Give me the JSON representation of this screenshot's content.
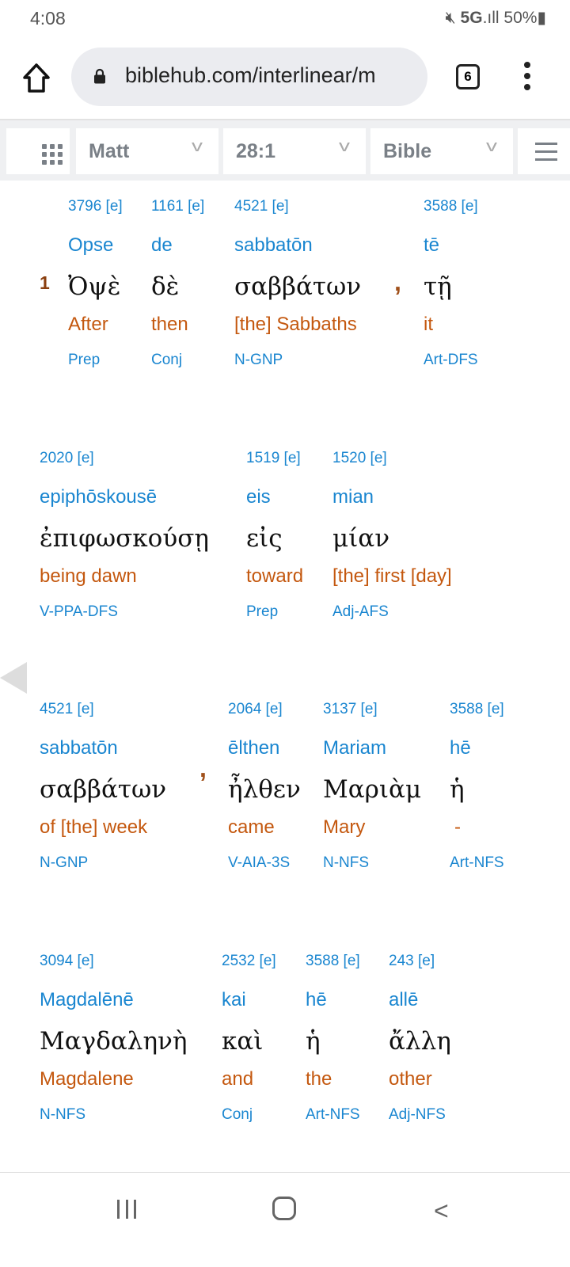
{
  "status": {
    "time": "4:08",
    "icons": "mute-icon 5G signal-icon",
    "battery": "50%",
    "network": "5G"
  },
  "browser": {
    "url": "biblehub.com/interlinear/m",
    "tab_count": "6"
  },
  "nav": {
    "book": "Matt",
    "chapter_verse": "28:1",
    "version": "Bible"
  },
  "verse": {
    "number": "1"
  },
  "colors": {
    "link": "#1a86d0",
    "english": "#c4580f",
    "verse_number": "#8b4010"
  },
  "words": [
    {
      "strong": "3796 [e]",
      "translit": "Opse",
      "greek": "Ὀψὲ",
      "english": "After",
      "parse": "Prep"
    },
    {
      "strong": "1161 [e]",
      "translit": "de",
      "greek": "δὲ",
      "english": "then",
      "parse": "Conj"
    },
    {
      "strong": "4521 [e]",
      "translit": "sabbatōn",
      "greek": "σαββάτων",
      "english": "[the] Sabbaths",
      "parse": "N-GNP"
    },
    {
      "strong": "3588 [e]",
      "translit": "tē",
      "greek": "τῇ",
      "english": "it",
      "parse": "Art-DFS"
    },
    {
      "strong": "2020 [e]",
      "translit": "epiphōskousē",
      "greek": "ἐπιφωσκούσῃ",
      "english": "being dawn",
      "parse": "V-PPA-DFS"
    },
    {
      "strong": "1519 [e]",
      "translit": "eis",
      "greek": "εἰς",
      "english": "toward",
      "parse": "Prep"
    },
    {
      "strong": "1520 [e]",
      "translit": "mian",
      "greek": "μίαν",
      "english": "[the] first [day]",
      "parse": "Adj-AFS"
    },
    {
      "strong": "4521 [e]",
      "translit": "sabbatōn",
      "greek": "σαββάτων",
      "english": "of [the] week",
      "parse": "N-GNP"
    },
    {
      "strong": "2064 [e]",
      "translit": "ēlthen",
      "greek": "ἦλθεν",
      "english": "came",
      "parse": "V-AIA-3S"
    },
    {
      "strong": "3137 [e]",
      "translit": "Mariam",
      "greek": "Μαριὰμ",
      "english": "Mary",
      "parse": "N-NFS"
    },
    {
      "strong": "3588 [e]",
      "translit": "hē",
      "greek": "ἡ",
      "english": "-",
      "parse": "Art-NFS"
    },
    {
      "strong": "3094 [e]",
      "translit": "Magdalēnē",
      "greek": "Μαγδαληνὴ",
      "english": "Magdalene",
      "parse": "N-NFS"
    },
    {
      "strong": "2532 [e]",
      "translit": "kai",
      "greek": "καὶ",
      "english": "and",
      "parse": "Conj"
    },
    {
      "strong": "3588 [e]",
      "translit": "hē",
      "greek": "ἡ",
      "english": "the",
      "parse": "Art-NFS"
    },
    {
      "strong": "243 [e]",
      "translit": "allē",
      "greek": "ἄλλη",
      "english": "other",
      "parse": "Adj-NFS"
    }
  ],
  "punctuation": [
    ",",
    ","
  ]
}
